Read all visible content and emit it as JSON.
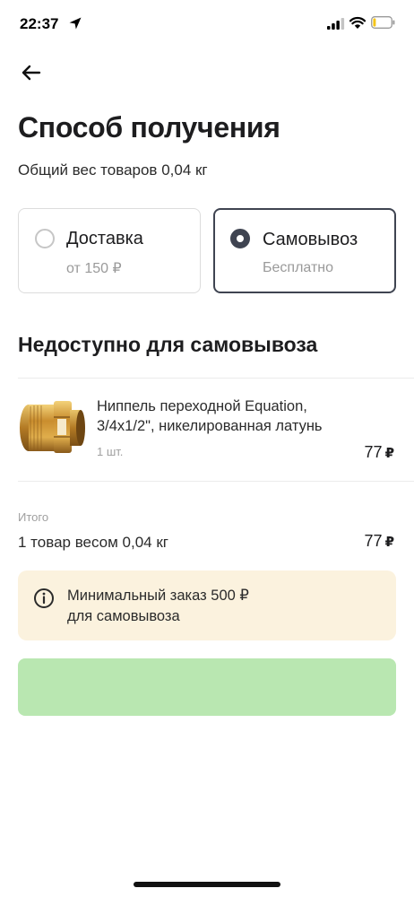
{
  "status_bar": {
    "time": "22:37"
  },
  "page": {
    "title": "Способ получения",
    "total_weight_text": "Общий вес товаров 0,04 кг"
  },
  "options": [
    {
      "label": "Доставка",
      "sublabel": "от 150 ₽",
      "selected": false
    },
    {
      "label": "Самовывоз",
      "sublabel": "Бесплатно",
      "selected": true
    }
  ],
  "unavailable": {
    "title": "Недоступно для самовывоза",
    "items": [
      {
        "name_line1": "Ниппель переходной Equation,",
        "name_line2": "3/4x1/2\", никелированная латунь",
        "quantity": "1 шт.",
        "price": "77",
        "currency": "₽"
      }
    ]
  },
  "summary": {
    "label": "Итого",
    "text": "1 товар весом 0,04 кг",
    "price": "77",
    "currency": "₽"
  },
  "notice": {
    "line1": "Минимальный заказ 500 ₽",
    "line2": "для самовывоза"
  },
  "colors": {
    "accent_dark": "#3f4451",
    "notice_bg": "#fbf2de",
    "button_disabled": "#b9e7b1"
  }
}
